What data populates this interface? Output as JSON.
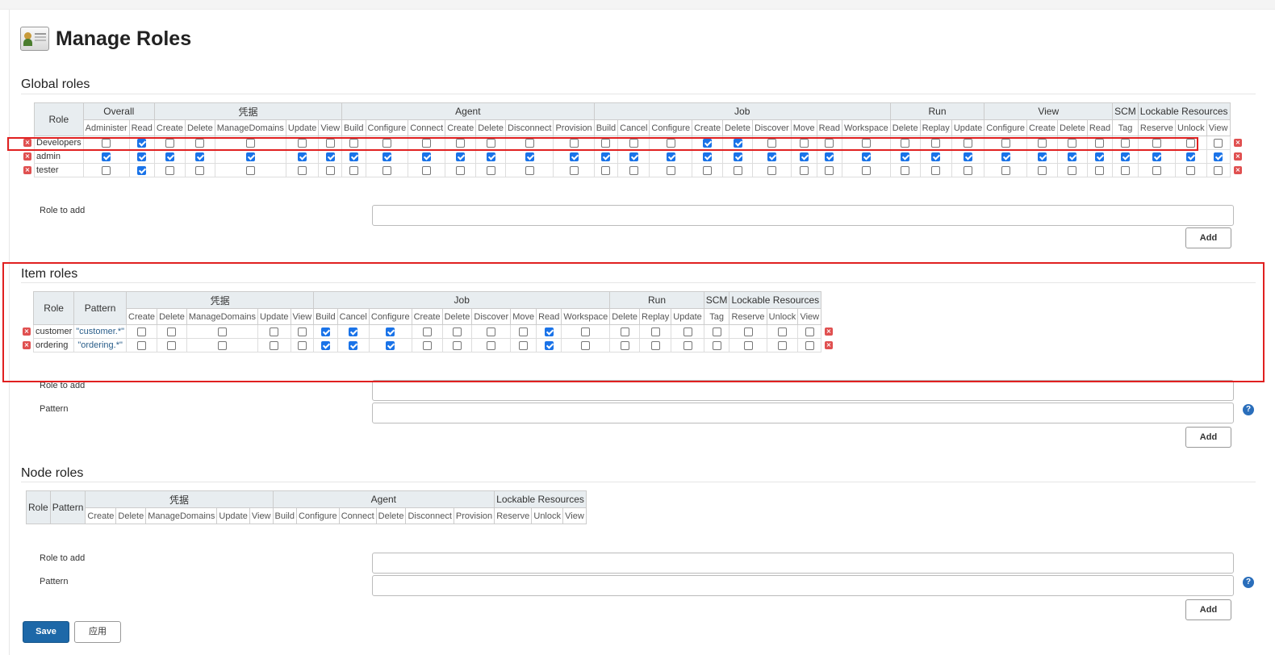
{
  "page_title": "Manage Roles",
  "global": {
    "section_title": "Global roles",
    "role_header": "Role",
    "groups": [
      {
        "name": "Overall",
        "perms": [
          "Administer",
          "Read"
        ]
      },
      {
        "name": "凭据",
        "perms": [
          "Create",
          "Delete",
          "ManageDomains",
          "Update",
          "View"
        ]
      },
      {
        "name": "Agent",
        "perms": [
          "Build",
          "Configure",
          "Connect",
          "Create",
          "Delete",
          "Disconnect",
          "Provision"
        ]
      },
      {
        "name": "Job",
        "perms": [
          "Build",
          "Cancel",
          "Configure",
          "Create",
          "Delete",
          "Discover",
          "Move",
          "Read",
          "Workspace"
        ]
      },
      {
        "name": "Run",
        "perms": [
          "Delete",
          "Replay",
          "Update"
        ]
      },
      {
        "name": "View",
        "perms": [
          "Configure",
          "Create",
          "Delete",
          "Read"
        ]
      },
      {
        "name": "SCM",
        "perms": [
          "Tag"
        ]
      },
      {
        "name": "Lockable Resources",
        "perms": [
          "Reserve",
          "Unlock",
          "View"
        ]
      }
    ],
    "roles": [
      {
        "name": "Developers",
        "checks": [
          0,
          1,
          0,
          0,
          0,
          0,
          0,
          0,
          0,
          0,
          0,
          0,
          0,
          0,
          0,
          0,
          0,
          1,
          1,
          0,
          0,
          0,
          0,
          0,
          0,
          0,
          0,
          0,
          0,
          0,
          0,
          0,
          0,
          0
        ]
      },
      {
        "name": "admin",
        "checks": [
          1,
          1,
          1,
          1,
          1,
          1,
          1,
          1,
          1,
          1,
          1,
          1,
          1,
          1,
          1,
          1,
          1,
          1,
          1,
          1,
          1,
          1,
          1,
          1,
          1,
          1,
          1,
          1,
          1,
          1,
          1,
          1,
          1,
          1
        ]
      },
      {
        "name": "tester",
        "checks": [
          0,
          1,
          0,
          0,
          0,
          0,
          0,
          0,
          0,
          0,
          0,
          0,
          0,
          0,
          0,
          0,
          0,
          0,
          0,
          0,
          0,
          0,
          0,
          0,
          0,
          0,
          0,
          0,
          0,
          0,
          0,
          0,
          0,
          0
        ]
      }
    ],
    "role_to_add_label": "Role to add",
    "add_label": "Add"
  },
  "item": {
    "section_title": "Item roles",
    "role_header": "Role",
    "pattern_header": "Pattern",
    "groups": [
      {
        "name": "凭据",
        "perms": [
          "Create",
          "Delete",
          "ManageDomains",
          "Update",
          "View"
        ]
      },
      {
        "name": "Job",
        "perms": [
          "Build",
          "Cancel",
          "Configure",
          "Create",
          "Delete",
          "Discover",
          "Move",
          "Read",
          "Workspace"
        ]
      },
      {
        "name": "Run",
        "perms": [
          "Delete",
          "Replay",
          "Update"
        ]
      },
      {
        "name": "SCM",
        "perms": [
          "Tag"
        ]
      },
      {
        "name": "Lockable Resources",
        "perms": [
          "Reserve",
          "Unlock",
          "View"
        ]
      }
    ],
    "roles": [
      {
        "name": "customer",
        "pattern": "\"customer.*\"",
        "checks": [
          0,
          0,
          0,
          0,
          0,
          1,
          1,
          1,
          0,
          0,
          0,
          0,
          1,
          0,
          0,
          0,
          0,
          0,
          0,
          0,
          0
        ]
      },
      {
        "name": "ordering",
        "pattern": "\"ordering.*\"",
        "checks": [
          0,
          0,
          0,
          0,
          0,
          1,
          1,
          1,
          0,
          0,
          0,
          0,
          1,
          0,
          0,
          0,
          0,
          0,
          0,
          0,
          0
        ]
      }
    ],
    "role_to_add_label": "Role to add",
    "pattern_label": "Pattern",
    "add_label": "Add"
  },
  "node": {
    "section_title": "Node roles",
    "role_header": "Role",
    "pattern_header": "Pattern",
    "groups": [
      {
        "name": "凭据",
        "perms": [
          "Create",
          "Delete",
          "ManageDomains",
          "Update",
          "View"
        ]
      },
      {
        "name": "Agent",
        "perms": [
          "Build",
          "Configure",
          "Connect",
          "Delete",
          "Disconnect",
          "Provision"
        ]
      },
      {
        "name": "Lockable Resources",
        "perms": [
          "Reserve",
          "Unlock",
          "View"
        ]
      }
    ],
    "roles": [],
    "role_to_add_label": "Role to add",
    "pattern_label": "Pattern",
    "add_label": "Add"
  },
  "help_icon_glyph": "?",
  "delete_icon_glyph": "×",
  "save_label": "Save",
  "apply_label": "应用",
  "colors": {
    "highlight": "#e02020",
    "checkbox_checked": "#1a73e8",
    "save_button": "#1d68a8",
    "delete_icon": "#e05050",
    "help_icon": "#2a6ebb"
  }
}
